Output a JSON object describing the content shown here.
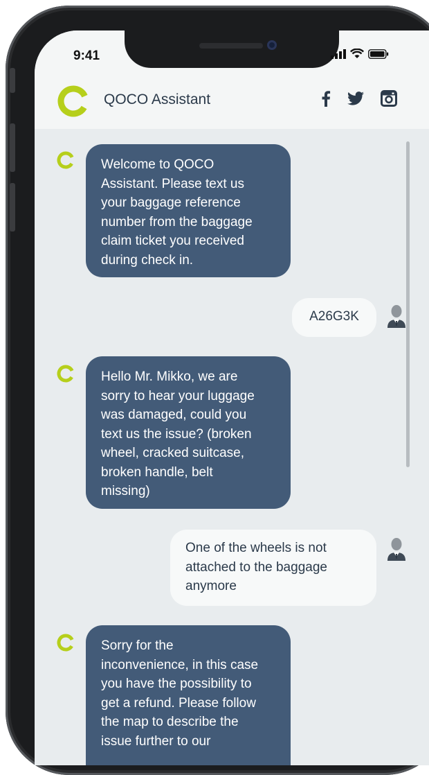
{
  "status_bar": {
    "time": "9:41"
  },
  "header": {
    "title": "QOCO Assistant"
  },
  "colors": {
    "bot_bubble": "#435b78",
    "user_bubble": "#f7f9f9",
    "brand_green": "#b6cf1b",
    "chat_bg": "#e8ecee"
  },
  "icons": [
    "qoco-logo-icon",
    "facebook-icon",
    "twitter-icon",
    "instagram-icon",
    "bot-avatar-icon",
    "user-avatar-icon",
    "signal-icon",
    "wifi-icon",
    "battery-icon"
  ],
  "messages": [
    {
      "sender": "bot",
      "text": "Welcome to QOCO\nAssistant. Please text us\nyour baggage reference\nnumber from the baggage\nclaim ticket you received\nduring check in."
    },
    {
      "sender": "user",
      "text": "A26G3K"
    },
    {
      "sender": "bot",
      "text": "Hello Mr. Mikko, we are\nsorry to hear your luggage\nwas damaged, could you\ntext us the issue? (broken\nwheel, cracked suitcase,\nbroken handle, belt\nmissing)"
    },
    {
      "sender": "user",
      "text": "One of the wheels is not\nattached to the baggage\nanymore"
    },
    {
      "sender": "bot",
      "text": "Sorry for the\ninconvenience, in this case\nyou have the possibility to\nget a refund. Please follow\nthe map to describe the\nissue further to our"
    }
  ]
}
